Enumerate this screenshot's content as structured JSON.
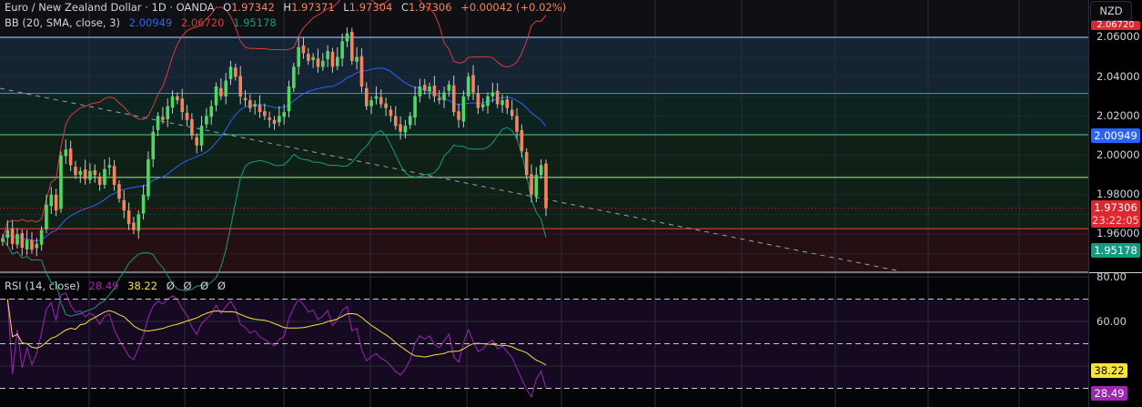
{
  "header": {
    "symbol": "Euro / New Zealand Dollar · 1D · OANDA",
    "open_label": "O",
    "open": "1.97342",
    "high_label": "H",
    "high": "1.97371",
    "low_label": "L",
    "low": "1.97304",
    "close_label": "C",
    "close": "1.97306",
    "change": "+0.00042 (+0.02%)"
  },
  "bb": {
    "label": "BB (20, SMA, close, 3)",
    "basis": "2.00949",
    "upper": "2.06720",
    "lower": "1.95178"
  },
  "rsi": {
    "label": "RSI (14, close)",
    "value": "28.49",
    "ma": "38.22",
    "extras": [
      "Ø",
      "Ø",
      "Ø",
      "Ø"
    ]
  },
  "axis": {
    "currency": "NZD",
    "price_ticks": [
      "2.06000",
      "2.04000",
      "2.02000",
      "2.00000",
      "1.98000",
      "1.96000"
    ],
    "upper_badge": "2.06720",
    "basis_badge": "2.00949",
    "last_price": "1.97306",
    "countdown": "23:22:05",
    "lower_badge": "1.95178",
    "rsi_ticks": [
      "80.00",
      "60.00"
    ],
    "rsi_ma_badge": "38.22",
    "rsi_badge": "28.49"
  },
  "colors": {
    "up": "#4cd964",
    "down": "#f4845f",
    "basis": "#2962ff",
    "upper": "#e0383e",
    "lower": "#159a82",
    "rsi": "#9c27b0",
    "rsi_ma": "#f5e33b",
    "last": "#e0262e"
  },
  "chart_data": {
    "type": "candlestick",
    "price_range": [
      1.94,
      2.07
    ],
    "levels": [
      2.06,
      2.0315,
      2.0105,
      1.9888,
      1.9627
    ],
    "closes": [
      1.958,
      1.962,
      1.955,
      1.96,
      1.953,
      1.957,
      1.952,
      1.955,
      1.962,
      1.975,
      1.98,
      1.972,
      2.0,
      2.003,
      1.995,
      1.99,
      1.992,
      1.988,
      1.992,
      1.99,
      1.985,
      1.993,
      1.995,
      1.985,
      1.978,
      1.972,
      1.965,
      1.962,
      1.97,
      1.98,
      1.998,
      2.012,
      2.02,
      2.018,
      2.025,
      2.03,
      2.028,
      2.022,
      2.018,
      2.01,
      2.005,
      2.015,
      2.02,
      2.025,
      2.035,
      2.03,
      2.038,
      2.045,
      2.04,
      2.03,
      2.028,
      2.024,
      2.026,
      2.022,
      2.02,
      2.018,
      2.016,
      2.02,
      2.022,
      2.035,
      2.045,
      2.055,
      2.052,
      2.048,
      2.05,
      2.045,
      2.048,
      2.053,
      2.045,
      2.05,
      2.058,
      2.062,
      2.048,
      2.05,
      2.035,
      2.025,
      2.028,
      2.03,
      2.026,
      2.024,
      2.02,
      2.015,
      2.012,
      2.015,
      2.02,
      2.03,
      2.035,
      2.033,
      2.035,
      2.03,
      2.028,
      2.032,
      2.036,
      2.022,
      2.018,
      2.03,
      2.04,
      2.032,
      2.024,
      2.026,
      2.03,
      2.032,
      2.026,
      2.028,
      2.024,
      2.02,
      2.012,
      2.002,
      1.99,
      1.98,
      1.99,
      1.995,
      1.97306
    ],
    "rsi_range": [
      20,
      85
    ],
    "rsi_levels": [
      70,
      50,
      30
    ]
  }
}
